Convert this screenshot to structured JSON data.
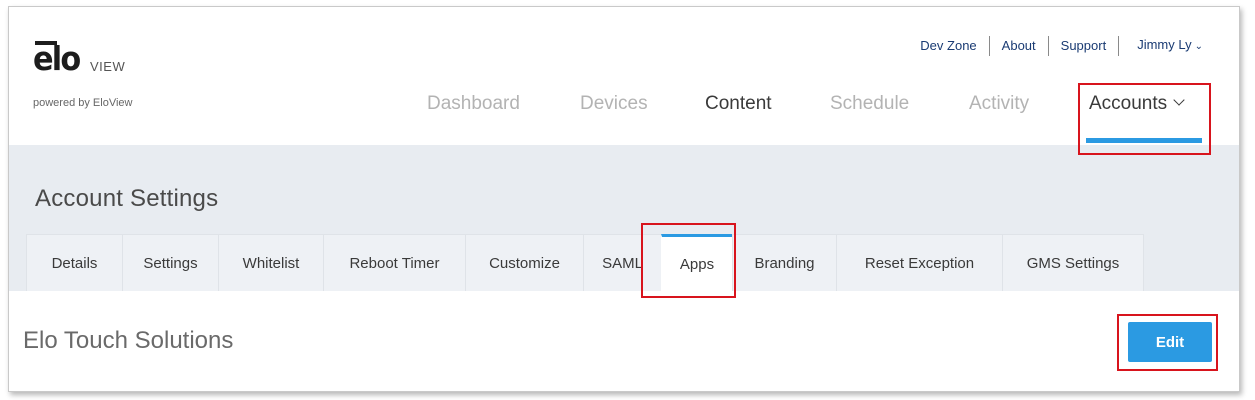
{
  "logo": {
    "word": "elo",
    "suffix": "VIEW",
    "tagline": "powered by EloView"
  },
  "utility_nav": {
    "dev_zone": "Dev Zone",
    "about": "About",
    "support": "Support",
    "user": "Jimmy Ly"
  },
  "main_nav": {
    "dashboard": "Dashboard",
    "devices": "Devices",
    "content": "Content",
    "schedule": "Schedule",
    "activity": "Activity",
    "accounts": "Accounts"
  },
  "page": {
    "title": "Account Settings",
    "tabs": [
      "Details",
      "Settings",
      "Whitelist",
      "Reboot Timer",
      "Customize",
      "SAML",
      "Apps",
      "Branding",
      "Reset Exception",
      "GMS Settings"
    ],
    "active_tab": "Apps"
  },
  "content": {
    "organization": "Elo Touch Solutions",
    "edit_label": "Edit"
  },
  "colors": {
    "accent": "#2b9ae2",
    "highlight": "#d8141d",
    "band_bg": "#e8ecf1",
    "nav_inactive": "#b3b3b3",
    "util_link": "#1a3b73"
  }
}
